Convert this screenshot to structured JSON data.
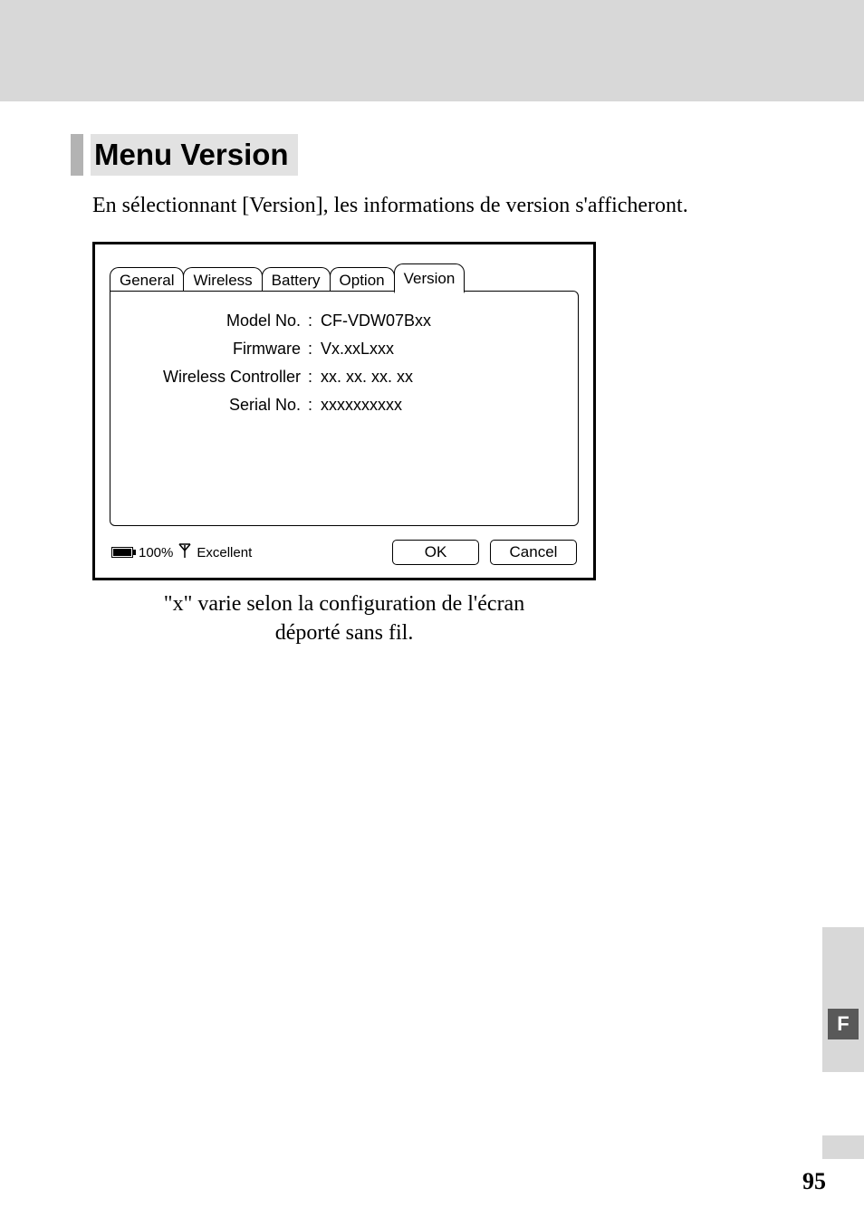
{
  "page": {
    "heading": "Menu Version",
    "intro": "En sélectionnant [Version], les informations de version s'afficheront.",
    "caption_line1": "\"x\" varie selon la configuration de l'écran",
    "caption_line2": "déporté sans fil.",
    "side_letter": "F",
    "number": "95"
  },
  "dialog": {
    "tabs": {
      "general": "General",
      "wireless": "Wireless",
      "battery": "Battery",
      "option": "Option",
      "version": "Version"
    },
    "fields": {
      "model_no": {
        "label": "Model No.",
        "value": "CF-VDW07Bxx"
      },
      "firmware": {
        "label": "Firmware",
        "value": "Vx.xxLxxx"
      },
      "wireless_controller": {
        "label": "Wireless Controller",
        "value": "xx. xx. xx. xx"
      },
      "serial_no": {
        "label": "Serial No.",
        "value": "xxxxxxxxxx"
      }
    },
    "status": {
      "battery_pct": "100%",
      "signal_text": "Excellent"
    },
    "buttons": {
      "ok": "OK",
      "cancel": "Cancel"
    }
  }
}
